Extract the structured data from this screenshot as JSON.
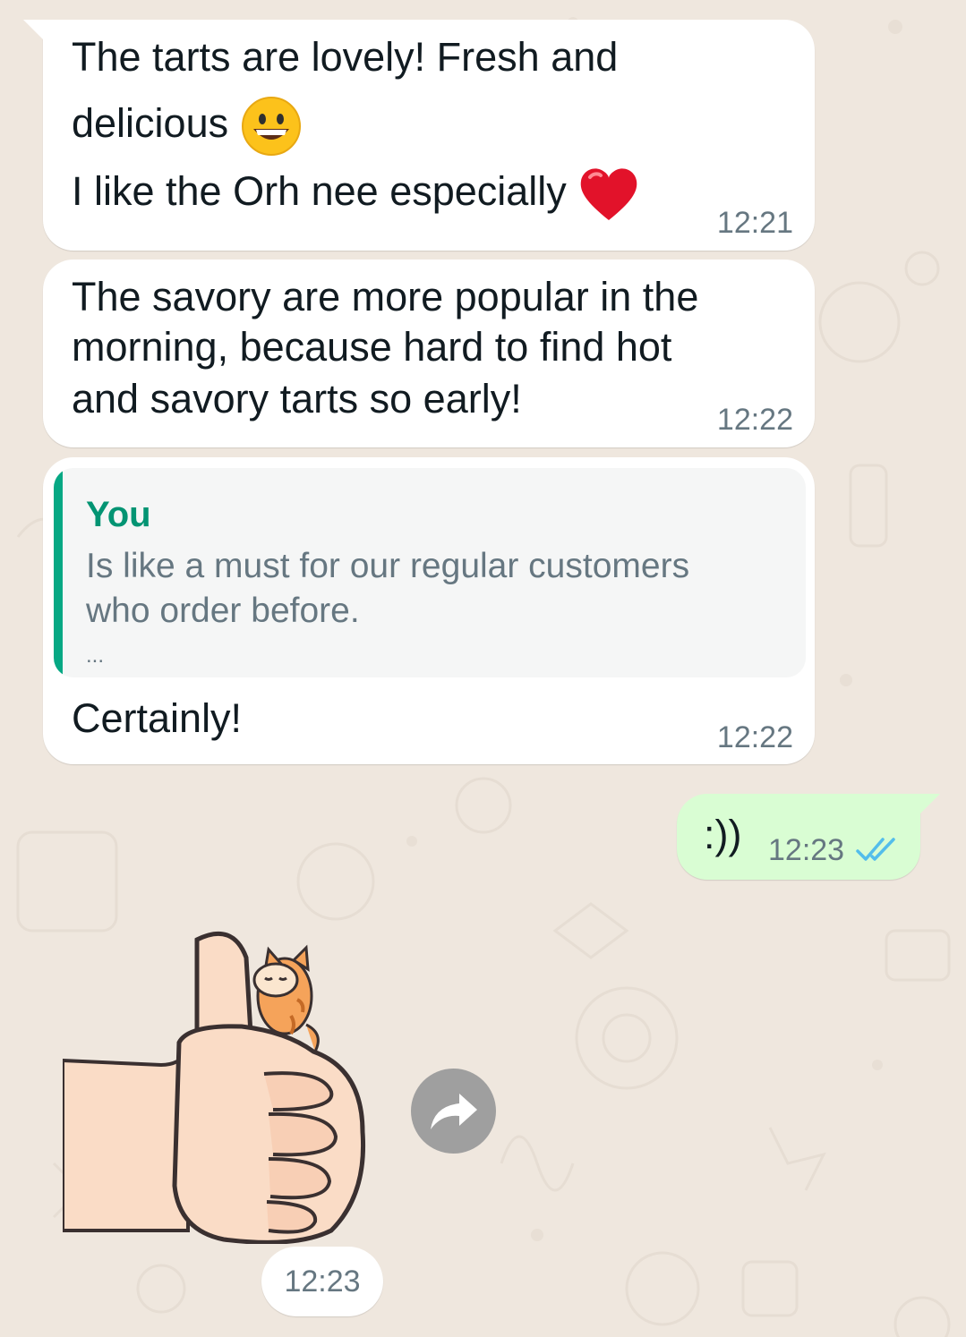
{
  "messages": [
    {
      "lines": [
        "The tarts are lovely! Fresh and",
        "delicious",
        "I like the Orh nee especially"
      ],
      "emojis": [
        "grinning-face-emoji",
        "red-heart-emoji"
      ],
      "time": "12:21"
    },
    {
      "lines": [
        "The savory are more popular in the",
        "morning, because hard to find hot",
        "and savory tarts so early!"
      ],
      "time": "12:22"
    },
    {
      "quote": {
        "author": "You",
        "lines": [
          "Is like a must for our regular customers",
          "who order before.",
          "..."
        ]
      },
      "lines": [
        "Certainly!"
      ],
      "time": "12:22"
    }
  ],
  "outgoing": {
    "text": ":))",
    "time": "12:23",
    "status_icon": "double-check-read-icon",
    "status_color": "#53bdeb"
  },
  "sticker": {
    "icon": "cat-on-thumbs-up-sticker",
    "time": "12:23",
    "forward_icon": "forward-arrow-icon"
  },
  "colors": {
    "background": "#efe7de",
    "incoming_bubble": "#ffffff",
    "outgoing_bubble": "#d9fdd3",
    "quote_accent": "#06a884",
    "quote_author": "#039473",
    "timestamp": "#667781"
  }
}
